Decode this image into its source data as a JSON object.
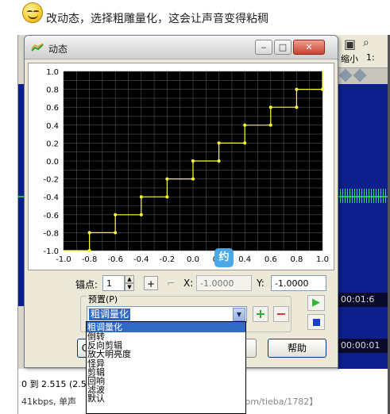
{
  "caption": {
    "text": "改动态，选择粗雕量化，这会让声音变得粘稠"
  },
  "host": {
    "toolbar_label_1": "缩小",
    "toolbar_label_2": "1:",
    "time_1": "00:01:6",
    "time_2": "00:00:01",
    "status_line": "0 到 2.515 (2.51",
    "format_line": "41kbps, 单声",
    "watermark": "Unity3D游戏专题  【www.lineeg.com/tieba/1782】"
  },
  "dialog": {
    "title": "动态",
    "min_label": "‒",
    "max_label": "□",
    "close_label": "✕",
    "graph": {
      "x_ticks": [
        "-1.0",
        "-0.8",
        "-0.6",
        "-0.4",
        "-0.2",
        "0.0",
        "0.2",
        "0.4",
        "0.6",
        "0.8",
        "1.0"
      ],
      "y_ticks": [
        "1.0",
        "0.8",
        "0.6",
        "0.4",
        "0.2",
        "0.0",
        "-0.2",
        "-0.4",
        "-0.6",
        "-0.8",
        "-1.0"
      ]
    },
    "anchor": {
      "label": "锚点:",
      "value": "1",
      "x_label": "X:",
      "x_value": "-1.0000",
      "y_label": "Y:",
      "y_value": "-1.0000"
    },
    "preset": {
      "label": "预置(P)",
      "selected": "粗调量化"
    },
    "buttons": {
      "ok": "C",
      "help": "帮助"
    }
  },
  "dropdown": {
    "items": [
      "粗调量化",
      "倒转",
      "反向剪辑",
      "放大明亮度",
      "怪异",
      "剪辑",
      "回响",
      "滤波",
      "默认"
    ]
  },
  "chart_data": {
    "type": "line",
    "title": "",
    "xlabel": "",
    "ylabel": "",
    "xlim": [
      -1.0,
      1.0
    ],
    "ylim": [
      -1.0,
      1.0
    ],
    "grid": true,
    "series": [
      {
        "x": [
          -1.0,
          -0.8,
          -0.8,
          -0.6,
          -0.6,
          -0.4,
          -0.4,
          -0.2,
          -0.2,
          0.0,
          0.0,
          0.2,
          0.2,
          0.4,
          0.4,
          0.6,
          0.6,
          0.8,
          0.8,
          1.0,
          1.0
        ],
        "y": [
          -1.0,
          -1.0,
          -0.8,
          -0.8,
          -0.6,
          -0.6,
          -0.4,
          -0.4,
          -0.2,
          -0.2,
          0.0,
          0.0,
          0.2,
          0.2,
          0.4,
          0.4,
          0.6,
          0.6,
          0.8,
          0.8,
          1.0
        ],
        "color": "#ffff33"
      }
    ],
    "background": "#000000",
    "grid_color": "#555555"
  }
}
